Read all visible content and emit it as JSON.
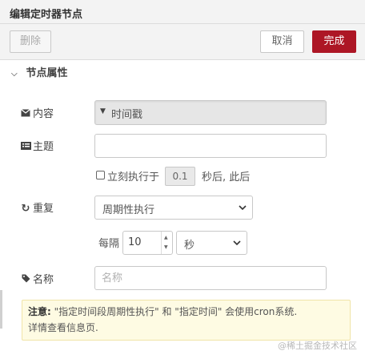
{
  "header": {
    "title": "编辑定时器节点"
  },
  "toolbar": {
    "delete_label": "删除",
    "cancel_label": "取消",
    "done_label": "完成"
  },
  "section": {
    "label": "节点属性",
    "icon": "chevron-down-icon"
  },
  "fields": {
    "payload": {
      "label": "内容",
      "icon": "envelope-icon",
      "value": "时间戳"
    },
    "topic": {
      "label": "主题",
      "icon": "tasks-icon",
      "value": ""
    },
    "once": {
      "label": "立刻执行于",
      "delay": "0.1",
      "after": "秒后, 此后",
      "checked": false
    },
    "repeat": {
      "label": "重复",
      "icon": "repeat-icon",
      "value": "周期性执行"
    },
    "interval": {
      "every_label": "每隔",
      "value": "10",
      "unit": "秒"
    },
    "name": {
      "label": "名称",
      "icon": "tag-icon",
      "placeholder": "名称"
    }
  },
  "note": {
    "bold": "注意:",
    "line1": " \"指定时间段周期性执行\" 和 \"指定时间\" 会使用cron系统.",
    "line2": "详情查看信息页."
  },
  "watermark": "@稀土掘金技术社区",
  "colors": {
    "primary": "#ad1625",
    "note_bg": "#fefbe3"
  }
}
